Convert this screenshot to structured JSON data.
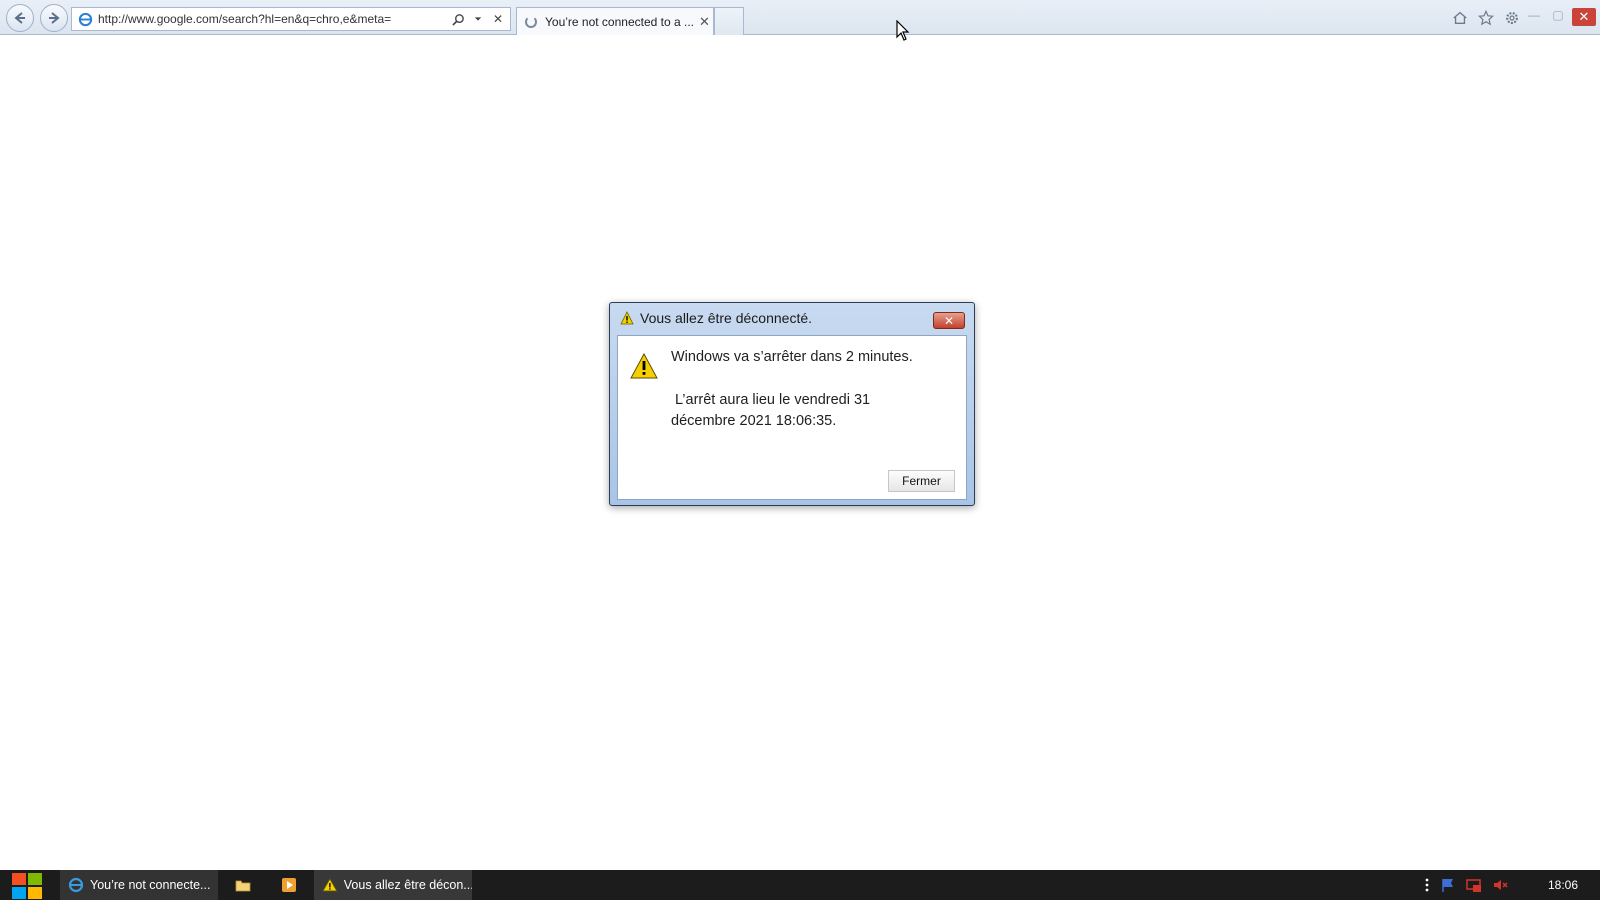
{
  "browser": {
    "address_url": "http://www.google.com/search?hl=en&q=chro,e&meta=",
    "tab_title": "You’re not connected to a ...",
    "tab_close_glyph": "✕",
    "address_stop_glyph": "✕"
  },
  "dialog": {
    "title": "Vous allez être déconnecté.",
    "message_line1": "Windows va s’arrêter dans 2 minutes.",
    "message_line2": " L’arrêt aura lieu le vendredi 31\ndécembre 2021 18:06:35.",
    "close_button_label": "Fermer",
    "close_glyph": "✕"
  },
  "taskbar": {
    "items": [
      {
        "label": "You’re not connecte...",
        "icon": "ie-icon"
      },
      {
        "label": "",
        "icon": "folder-icon"
      },
      {
        "label": "",
        "icon": "media-player-icon"
      },
      {
        "label": "Vous allez être décon...",
        "icon": "warning-icon"
      }
    ],
    "clock": "18:06"
  },
  "colors": {
    "taskbar_bg": "#1c1c1c",
    "dialog_frame": "#a9c4e6",
    "close_red": "#c9443a",
    "warning_yellow": "#f5d000"
  }
}
